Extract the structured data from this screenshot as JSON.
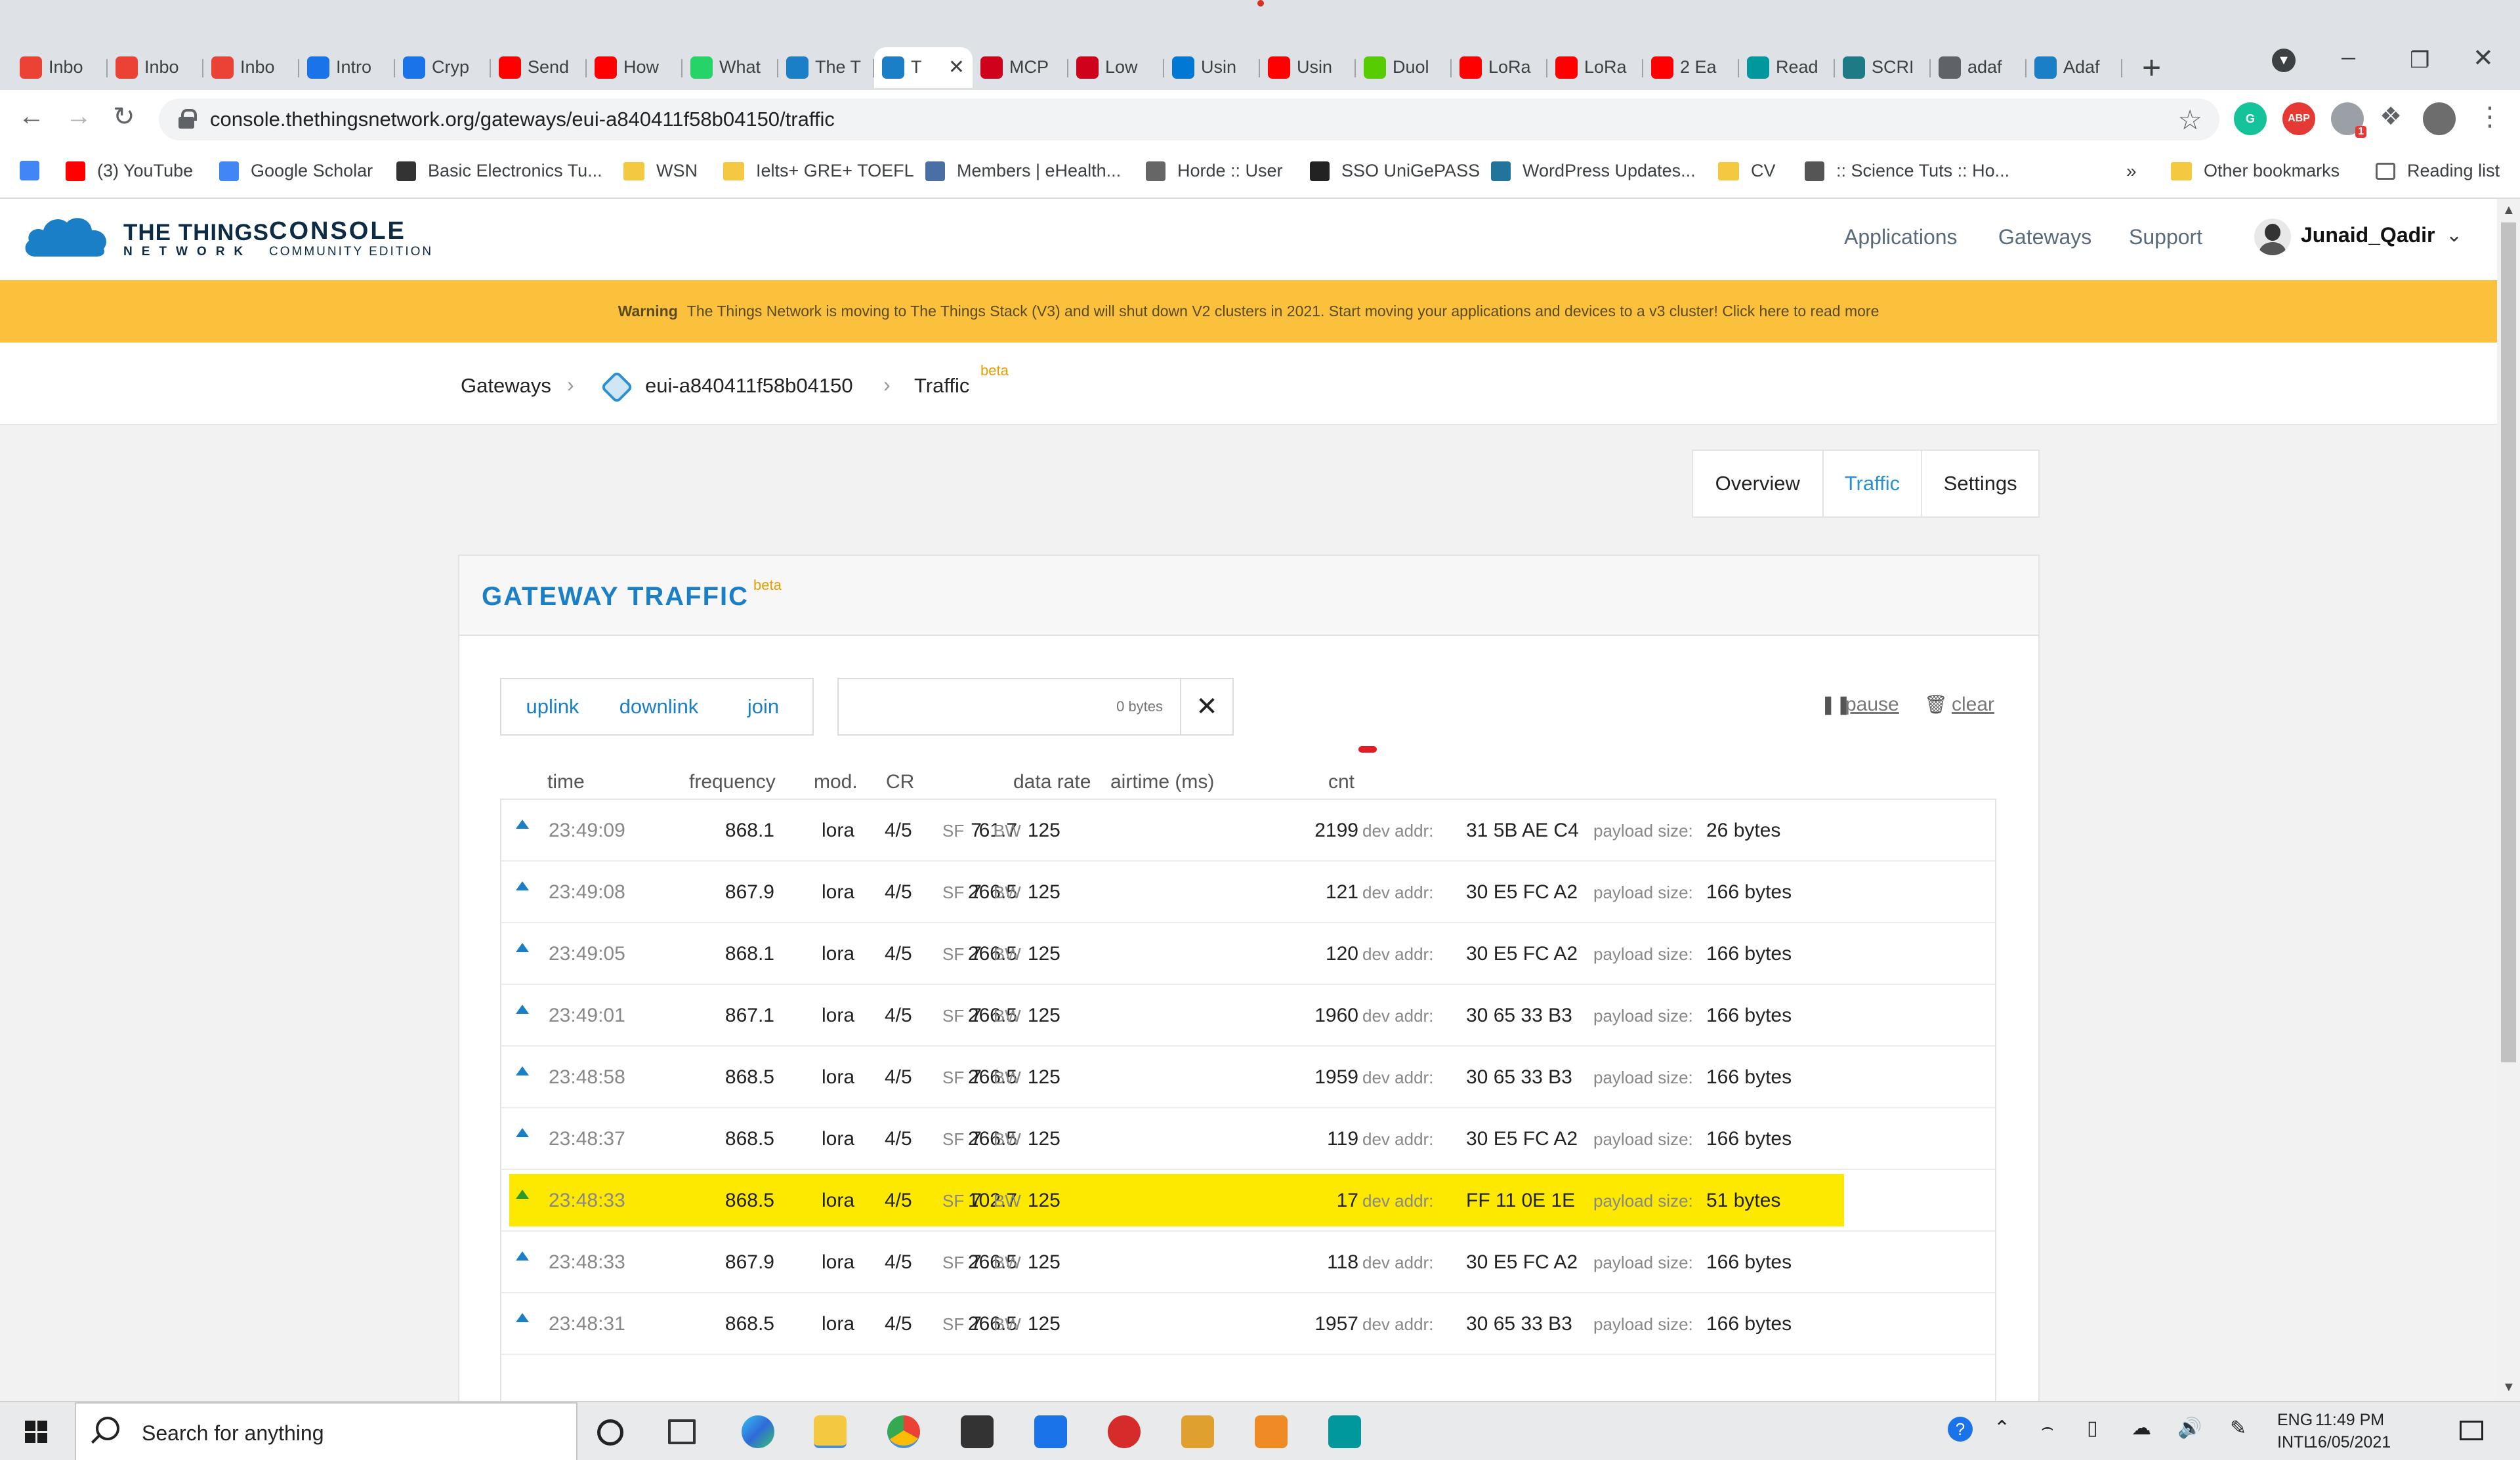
{
  "browser": {
    "tabs": [
      {
        "title": "Inbo",
        "icon": "gmail-icon",
        "color": "#ea4335"
      },
      {
        "title": "Inbo",
        "icon": "gmail-icon",
        "color": "#ea4335"
      },
      {
        "title": "Inbo",
        "icon": "gmail-icon",
        "color": "#ea4335"
      },
      {
        "title": "Intro",
        "icon": "c-circle-icon",
        "color": "#1a73e8"
      },
      {
        "title": "Cryp",
        "icon": "c-circle-icon",
        "color": "#1a73e8"
      },
      {
        "title": "Send",
        "icon": "youtube-icon",
        "color": "#ff0000"
      },
      {
        "title": "How",
        "icon": "youtube-icon",
        "color": "#ff0000"
      },
      {
        "title": "What",
        "icon": "whatsapp-icon",
        "color": "#25d366"
      },
      {
        "title": "The T",
        "icon": "ttn-cloud-icon",
        "color": "#1a7fc6"
      },
      {
        "title": "T",
        "icon": "ttn-cloud-icon",
        "color": "#1a7fc6",
        "active": true
      },
      {
        "title": "MCP",
        "icon": "microchip-icon",
        "color": "#d0021b"
      },
      {
        "title": "Low",
        "icon": "microchip-icon",
        "color": "#d0021b"
      },
      {
        "title": "Usin",
        "icon": "vscode-icon",
        "color": "#0078d4"
      },
      {
        "title": "Usin",
        "icon": "youtube-icon",
        "color": "#ff0000"
      },
      {
        "title": "Duol",
        "icon": "duolingo-icon",
        "color": "#58cc02"
      },
      {
        "title": "LoRa",
        "icon": "youtube-icon",
        "color": "#ff0000"
      },
      {
        "title": "LoRa",
        "icon": "youtube-icon",
        "color": "#ff0000"
      },
      {
        "title": "2 Ea",
        "icon": "youtube-icon",
        "color": "#ff0000"
      },
      {
        "title": "Read",
        "icon": "arduino-icon",
        "color": "#00979d"
      },
      {
        "title": "SCRI",
        "icon": "scribd-icon",
        "color": "#1e7b85"
      },
      {
        "title": "adaf",
        "icon": "globe-icon",
        "color": "#5f6368"
      },
      {
        "title": "Adaf",
        "icon": "ttn-cloud-icon",
        "color": "#1a7fc6"
      }
    ],
    "url": "console.thethingsnetwork.org/gateways/eui-a840411f58b04150/traffic",
    "extension_badges": [
      "G",
      "ABP",
      "1"
    ],
    "bookmarks": [
      {
        "label": "",
        "icon": "google-icon",
        "color": "#4285f4"
      },
      {
        "label": "(3) YouTube",
        "icon": "youtube-icon",
        "color": "#ff0000"
      },
      {
        "label": "Google Scholar",
        "icon": "scholar-icon",
        "color": "#4285f4"
      },
      {
        "label": "Basic Electronics Tu...",
        "icon": "shield-icon",
        "color": "#333333"
      },
      {
        "label": "WSN",
        "icon": "folder-icon",
        "color": "#f5c842"
      },
      {
        "label": "Ielts+ GRE+ TOEFL",
        "icon": "folder-icon",
        "color": "#f5c842"
      },
      {
        "label": "Members | eHealth...",
        "icon": "ehealth-icon",
        "color": "#4a6fa5"
      },
      {
        "label": "Horde :: User",
        "icon": "horde-icon",
        "color": "#666666"
      },
      {
        "label": "SSO UniGePASS",
        "icon": "crest-icon",
        "color": "#222222"
      },
      {
        "label": "WordPress Updates...",
        "icon": "wordpress-icon",
        "color": "#21759b"
      },
      {
        "label": "CV",
        "icon": "folder-icon",
        "color": "#f5c842"
      },
      {
        "label": ":: Science Tuts :: Ho...",
        "icon": "info-icon",
        "color": "#555555"
      }
    ],
    "bookmarks_more": "»",
    "other_bookmarks": "Other bookmarks",
    "reading_list": "Reading list"
  },
  "header": {
    "logo_line1": "THE THINGS",
    "logo_line2": "NETWORK",
    "console": "CONSOLE",
    "edition": "COMMUNITY EDITION",
    "nav": [
      "Applications",
      "Gateways",
      "Support"
    ],
    "username": "Junaid_Qadir"
  },
  "warning": {
    "label": "Warning",
    "text": "The Things Network is moving to The Things Stack (V3) and will shut down V2 clusters in 2021. Start moving your applications and devices to a v3 cluster! Click here to read more"
  },
  "breadcrumb": {
    "root": "Gateways",
    "gateway": "eui-a840411f58b04150",
    "current": "Traffic",
    "badge": "beta"
  },
  "subnav": {
    "items": [
      "Overview",
      "Traffic",
      "Settings"
    ],
    "active": "Traffic"
  },
  "traffic": {
    "title": "GATEWAY TRAFFIC",
    "badge": "beta",
    "filters": [
      "uplink",
      "downlink",
      "join"
    ],
    "search_placeholder": "0 bytes",
    "pause": "pause",
    "clear": "clear",
    "columns": [
      "time",
      "frequency",
      "mod.",
      "CR",
      "data rate",
      "airtime (ms)",
      "cnt"
    ],
    "labels": {
      "sf": "SF",
      "bw": "BW",
      "dev_addr": "dev addr:",
      "payload": "payload size:"
    },
    "rows": [
      {
        "time": "23:49:09",
        "freq": "868.1",
        "mod": "lora",
        "cr": "4/5",
        "sf": "7",
        "bw": "125",
        "airtime": "61.7",
        "cnt": "2199",
        "dev": "31 5B AE C4",
        "payload": "26 bytes"
      },
      {
        "time": "23:49:08",
        "freq": "867.9",
        "mod": "lora",
        "cr": "4/5",
        "sf": "7",
        "bw": "125",
        "airtime": "266.5",
        "cnt": "121",
        "dev": "30 E5 FC A2",
        "payload": "166 bytes"
      },
      {
        "time": "23:49:05",
        "freq": "868.1",
        "mod": "lora",
        "cr": "4/5",
        "sf": "7",
        "bw": "125",
        "airtime": "266.5",
        "cnt": "120",
        "dev": "30 E5 FC A2",
        "payload": "166 bytes"
      },
      {
        "time": "23:49:01",
        "freq": "867.1",
        "mod": "lora",
        "cr": "4/5",
        "sf": "7",
        "bw": "125",
        "airtime": "266.5",
        "cnt": "1960",
        "dev": "30 65 33 B3",
        "payload": "166 bytes"
      },
      {
        "time": "23:48:58",
        "freq": "868.5",
        "mod": "lora",
        "cr": "4/5",
        "sf": "7",
        "bw": "125",
        "airtime": "266.5",
        "cnt": "1959",
        "dev": "30 65 33 B3",
        "payload": "166 bytes"
      },
      {
        "time": "23:48:37",
        "freq": "868.5",
        "mod": "lora",
        "cr": "4/5",
        "sf": "7",
        "bw": "125",
        "airtime": "266.5",
        "cnt": "119",
        "dev": "30 E5 FC A2",
        "payload": "166 bytes"
      },
      {
        "time": "23:48:33",
        "freq": "868.5",
        "mod": "lora",
        "cr": "4/5",
        "sf": "7",
        "bw": "125",
        "airtime": "102.7",
        "cnt": "17",
        "dev": "FF 11 0E 1E",
        "payload": "51 bytes",
        "highlight": true
      },
      {
        "time": "23:48:33",
        "freq": "867.9",
        "mod": "lora",
        "cr": "4/5",
        "sf": "7",
        "bw": "125",
        "airtime": "266.5",
        "cnt": "118",
        "dev": "30 E5 FC A2",
        "payload": "166 bytes"
      },
      {
        "time": "23:48:31",
        "freq": "868.5",
        "mod": "lora",
        "cr": "4/5",
        "sf": "7",
        "bw": "125",
        "airtime": "266.5",
        "cnt": "1957",
        "dev": "30 65 33 B3",
        "payload": "166 bytes"
      }
    ],
    "highlight_color": "#fde800"
  },
  "taskbar": {
    "search_placeholder": "Search for anything",
    "lang_line1": "ENG",
    "lang_line2": "INTL",
    "time": "11:49 PM",
    "date": "16/05/2021"
  },
  "colors": {
    "accent": "#1a7fc6",
    "warning_bg": "#fcc13c",
    "beta": "#e5a000"
  }
}
